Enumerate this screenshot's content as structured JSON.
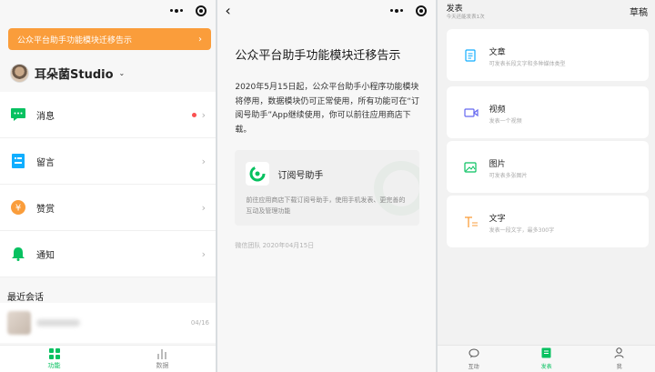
{
  "panel1": {
    "banner": {
      "text": "公众平台助手功能模块迁移告示",
      "chevron": "›"
    },
    "account": {
      "name": "耳朵菌Studio",
      "caret": "⌄"
    },
    "menu": [
      {
        "label": "消息",
        "icon": "message-icon",
        "color": "#07c160",
        "badge": true
      },
      {
        "label": "留言",
        "icon": "comment-icon",
        "color": "#10aeff",
        "badge": false
      },
      {
        "label": "赞赏",
        "icon": "reward-icon",
        "color": "#fa9d3b",
        "badge": false
      },
      {
        "label": "通知",
        "icon": "bell-icon",
        "color": "#07c160",
        "badge": false
      }
    ],
    "chevron": "›",
    "recent": {
      "title": "最近会话",
      "date": "04/16"
    },
    "tabs": [
      {
        "label": "功能",
        "icon": "grid-icon",
        "active": true
      },
      {
        "label": "数据",
        "icon": "chart-icon",
        "active": false
      }
    ]
  },
  "panel2": {
    "back": "‹",
    "title": "公众平台助手功能模块迁移告示",
    "body": "2020年5月15日起，公众平台助手小程序功能模块将停用，数据模块仍可正常使用，所有功能可在“订阅号助手”App继续使用，你可以前往应用商店下载。",
    "card": {
      "name": "订阅号助手",
      "desc": "前往应用商店下载订阅号助手，使用手机发表、更完善的互动及管理功能"
    },
    "footer": "微信团队 2020年04月15日"
  },
  "panel3": {
    "title": "发表",
    "subtitle": "今天还能发表1次",
    "draft": "草稿",
    "options": [
      {
        "title": "文章",
        "desc": "可发表长段文字和多种媒体类型",
        "icon": "article-icon"
      },
      {
        "title": "视频",
        "desc": "发表一个视频",
        "icon": "video-icon"
      },
      {
        "title": "图片",
        "desc": "可发表多张图片",
        "icon": "image-icon"
      },
      {
        "title": "文字",
        "desc": "发表一段文字，最多300字",
        "icon": "text-icon"
      }
    ],
    "tabs": [
      {
        "label": "互动",
        "icon": "chat-bubble-icon",
        "active": false
      },
      {
        "label": "发表",
        "icon": "publish-icon",
        "active": true
      },
      {
        "label": "我",
        "icon": "person-icon",
        "active": false
      }
    ]
  },
  "colors": {
    "brand_green": "#07c160",
    "banner_orange": "#fa9d3b",
    "badge_red": "#fa5151",
    "accent_blue": "#10aeff"
  }
}
